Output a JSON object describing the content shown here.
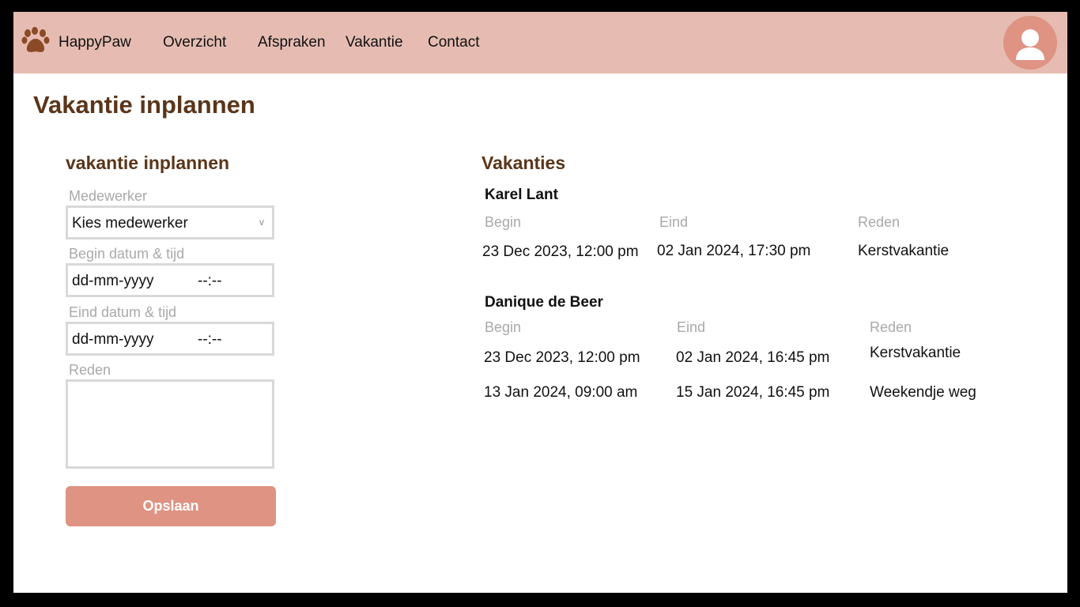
{
  "brand": {
    "name": "HappyPaw",
    "logo_icon": "paw-icon"
  },
  "nav": {
    "items": [
      {
        "label": "Overzicht"
      },
      {
        "label": "Afspraken"
      },
      {
        "label": "Vakantie"
      },
      {
        "label": "Contact"
      }
    ]
  },
  "user": {
    "avatar_icon": "user-avatar-icon"
  },
  "page": {
    "title": "Vakantie inplannen"
  },
  "form": {
    "title": "vakantie inplannen",
    "employee_label": "Medewerker",
    "employee_value": "Kies medewerker",
    "begin_label": "Begin datum & tijd",
    "begin_date_placeholder": "dd-mm-yyyy",
    "begin_time_placeholder": "--:--",
    "end_label": "Eind datum & tijd",
    "end_date_placeholder": "dd-mm-yyyy",
    "end_time_placeholder": "--:--",
    "reason_label": "Reden",
    "reason_value": "",
    "save_label": "Opslaan"
  },
  "vacations": {
    "title": "Vakanties",
    "employees": [
      {
        "name": "Karel Lant",
        "headers": {
          "begin": "Begin",
          "end": "Eind",
          "reason": "Reden"
        },
        "rows": [
          {
            "begin": "23 Dec 2023, 12:00 pm",
            "end": "02 Jan 2024, 17:30 pm",
            "reason": "Kerstvakantie"
          }
        ]
      },
      {
        "name": "Danique de Beer",
        "headers": {
          "begin": "Begin",
          "end": "Eind",
          "reason": "Reden"
        },
        "rows": [
          {
            "begin": "23 Dec 2023, 12:00 pm",
            "end": "02 Jan 2024, 16:45 pm",
            "reason": "Kerstvakantie"
          },
          {
            "begin": "13 Jan 2024, 09:00 am",
            "end": "15 Jan 2024, 16:45 pm",
            "reason": "Weekendje weg"
          }
        ]
      }
    ]
  },
  "colors": {
    "header_bg": "#e6bcb2",
    "accent": "#de9383",
    "title_brown": "#5a3519",
    "paw_brown": "#8b4a26"
  }
}
